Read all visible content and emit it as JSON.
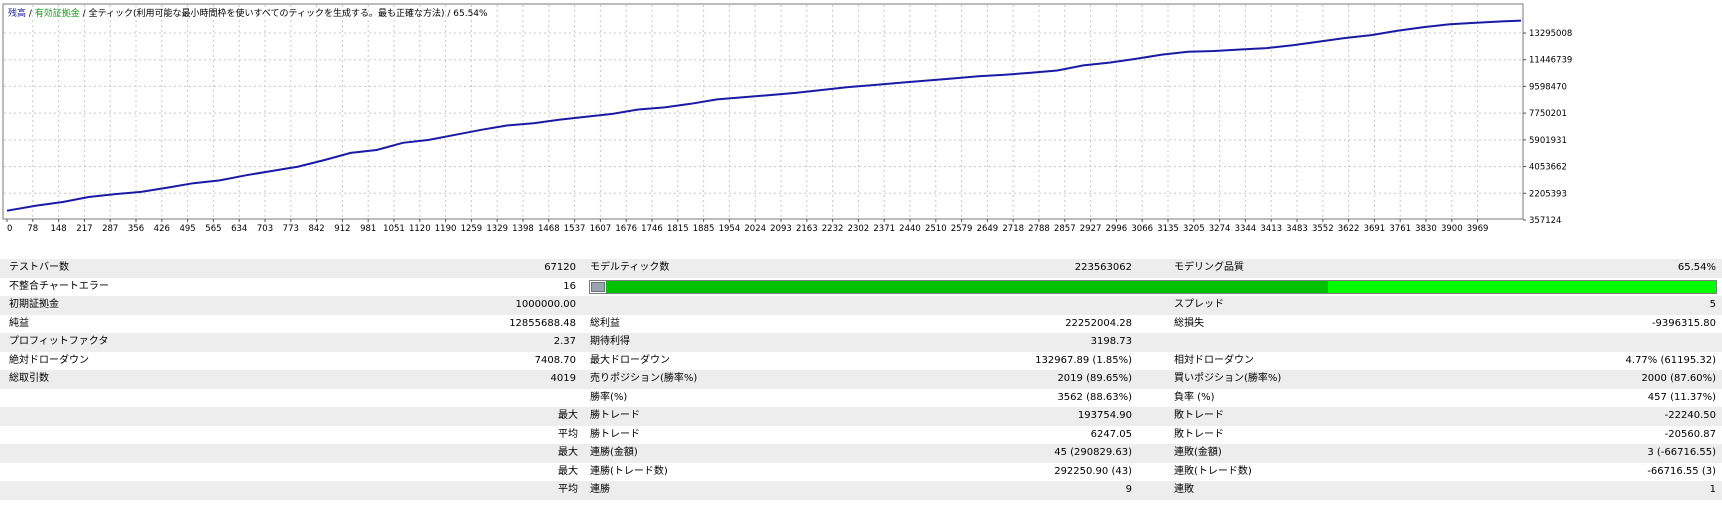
{
  "legend": {
    "balance": "残高",
    "sep1": " / ",
    "equity": "有効証拠金",
    "rest": " / 全ティック(利用可能な最小時間枠を使いすべてのティックを生成する。最も正確な方法) / 65.54%"
  },
  "chart_data": {
    "type": "line",
    "x_ticks": [
      "0",
      "78",
      "148",
      "217",
      "287",
      "356",
      "426",
      "495",
      "565",
      "634",
      "703",
      "773",
      "842",
      "912",
      "981",
      "1051",
      "1120",
      "1190",
      "1259",
      "1329",
      "1398",
      "1468",
      "1537",
      "1607",
      "1676",
      "1746",
      "1815",
      "1885",
      "1954",
      "2024",
      "2093",
      "2163",
      "2232",
      "2302",
      "2371",
      "2440",
      "2510",
      "2579",
      "2649",
      "2718",
      "2788",
      "2857",
      "2927",
      "2996",
      "3066",
      "3135",
      "3205",
      "3274",
      "3344",
      "3413",
      "3483",
      "3552",
      "3622",
      "3691",
      "3761",
      "3830",
      "3900",
      "3969"
    ],
    "y_ticks": [
      "13295008",
      "11446739",
      "9598470",
      "7750201",
      "5901931",
      "4053662",
      "2205393",
      "357124"
    ],
    "xlim": [
      0,
      4019
    ],
    "ylim": [
      357124,
      14500000
    ],
    "series": [
      {
        "color": "#1a1aa6",
        "x": [
          0,
          78,
          148,
          217,
          287,
          356,
          426,
          495,
          565,
          634,
          703,
          773,
          842,
          912,
          981,
          1051,
          1120,
          1190,
          1259,
          1329,
          1398,
          1468,
          1537,
          1607,
          1676,
          1746,
          1815,
          1885,
          1954,
          2024,
          2093,
          2163,
          2232,
          2302,
          2371,
          2440,
          2510,
          2579,
          2649,
          2718,
          2788,
          2857,
          2927,
          2996,
          3066,
          3135,
          3205,
          3274,
          3344,
          3413,
          3483,
          3552,
          3622,
          3691,
          3761,
          3830,
          3900,
          3969,
          4019
        ],
        "y": [
          1000000,
          1350000,
          1600000,
          1950000,
          2150000,
          2300000,
          2600000,
          2900000,
          3100000,
          3450000,
          3750000,
          4050000,
          4500000,
          5000000,
          5200000,
          5700000,
          5900000,
          6250000,
          6600000,
          6900000,
          7050000,
          7300000,
          7500000,
          7700000,
          8000000,
          8150000,
          8400000,
          8700000,
          8850000,
          9000000,
          9150000,
          9350000,
          9550000,
          9700000,
          9850000,
          10000000,
          10150000,
          10300000,
          10400000,
          10550000,
          10700000,
          11050000,
          11250000,
          11500000,
          11800000,
          12000000,
          12050000,
          12150000,
          12250000,
          12450000,
          12700000,
          12950000,
          13150000,
          13450000,
          13700000,
          13900000,
          14000000,
          14100000,
          14150000
        ]
      }
    ]
  },
  "stats": {
    "test_bars_label": "テストバー数",
    "test_bars": "67120",
    "model_ticks_label": "モデルティック数",
    "model_ticks": "223563062",
    "model_quality_label": "モデリング品質",
    "model_quality": "65.54%",
    "mismatch_label": "不整合チャートエラー",
    "mismatch": "16",
    "initial_deposit_label": "初期証拠金",
    "initial_deposit": "1000000.00",
    "spread_label": "スプレッド",
    "spread": "5",
    "net_profit_label": "純益",
    "net_profit": "12855688.48",
    "gross_profit_label": "総利益",
    "gross_profit": "22252004.28",
    "gross_loss_label": "総損失",
    "gross_loss": "-9396315.80",
    "profit_factor_label": "プロフィットファクタ",
    "profit_factor": "2.37",
    "expected_payoff_label": "期待利得",
    "expected_payoff": "3198.73",
    "abs_dd_label": "絶対ドローダウン",
    "abs_dd": "7408.70",
    "max_dd_label": "最大ドローダウン",
    "max_dd": "132967.89 (1.85%)",
    "rel_dd_label": "相対ドローダウン",
    "rel_dd": "4.77% (61195.32)",
    "total_trades_label": "総取引数",
    "total_trades": "4019",
    "short_label": "売りポジション(勝率%)",
    "short": "2019 (89.65%)",
    "long_label": "買いポジション(勝率%)",
    "long": "2000 (87.60%)",
    "win_rate_label": "勝率(%)",
    "win_rate": "3562 (88.63%)",
    "loss_rate_label": "負率 (%)",
    "loss_rate": "457 (11.37%)",
    "max": "最大",
    "avg": "平均",
    "win_trade_label": "勝トレード",
    "lose_trade_label": "敗トレード",
    "largest_win": "193754.90",
    "largest_loss": "-22240.50",
    "avg_win": "6247.05",
    "avg_loss": "-20560.87",
    "consec_win_amt_label": "連勝(金額)",
    "consec_win_amt": "45 (290829.63)",
    "consec_loss_amt_label": "連敗(金額)",
    "consec_loss_amt": "3 (-66716.55)",
    "consec_win_cnt_label": "連勝(トレード数)",
    "consec_win_cnt": "292250.90 (43)",
    "consec_loss_cnt_label": "連敗(トレード数)",
    "consec_loss_cnt": "-66716.55 (3)",
    "consec_win_label": "連勝",
    "consec_win": "9",
    "consec_loss_label": "連敗",
    "consec_loss": "1"
  }
}
